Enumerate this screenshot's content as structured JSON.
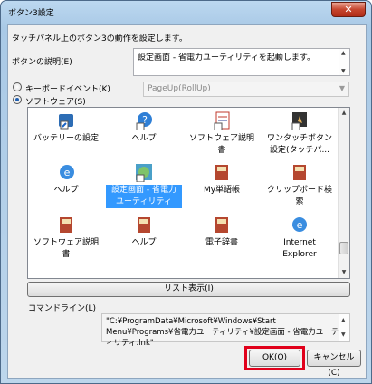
{
  "window": {
    "title": "ボタン3設定",
    "close_label": "✕"
  },
  "intro_text": "タッチパネル上のボタン3の動作を設定します。",
  "description": {
    "label": "ボタンの説明(E)",
    "value": "設定画面 - 省電力ユーティリティを起動します。"
  },
  "modes": {
    "keyboard_label": "キーボードイベント(K)",
    "keyboard_checked": false,
    "software_label": "ソフトウェア(S)",
    "software_checked": true,
    "key_combo_value": "PageUp(RollUp)"
  },
  "apps": [
    {
      "label": "バッテリーの設定",
      "icon": "battery-shortcut-icon"
    },
    {
      "label": "ヘルプ",
      "icon": "help-shortcut-icon"
    },
    {
      "label": "ソフトウェア説明書",
      "icon": "manual-shortcut-icon"
    },
    {
      "label": "ワンタッチボタン設定(タッチパ...",
      "icon": "touch-button-settings-icon"
    },
    {
      "label": "ヘルプ",
      "icon": "ie-help-icon"
    },
    {
      "label": "設定画面 - 省電力ユーティリティ",
      "icon": "power-utility-icon",
      "selected": true
    },
    {
      "label": "My単語帳",
      "icon": "book-icon"
    },
    {
      "label": "クリップボード検索",
      "icon": "clipboard-search-icon"
    },
    {
      "label": "ソフトウェア説明書",
      "icon": "manual-book-icon"
    },
    {
      "label": "ヘルプ",
      "icon": "help-book-icon"
    },
    {
      "label": "電子辞書",
      "icon": "dictionary-icon"
    },
    {
      "label": "Internet Explorer",
      "icon": "internet-explorer-icon"
    }
  ],
  "list_view_button": "リスト表示(I)",
  "command_line": {
    "label": "コマンドライン(L)",
    "value": "\"C:¥ProgramData¥Microsoft¥Windows¥Start Menu¥Programs¥省電力ユーティリティ¥設定画面 - 省電力ユーティリティ.lnk\""
  },
  "buttons": {
    "ok": "OK(O)",
    "cancel": "キャンセル(C)"
  },
  "colors": {
    "selection": "#3399ff",
    "highlight": "#e1001b"
  }
}
